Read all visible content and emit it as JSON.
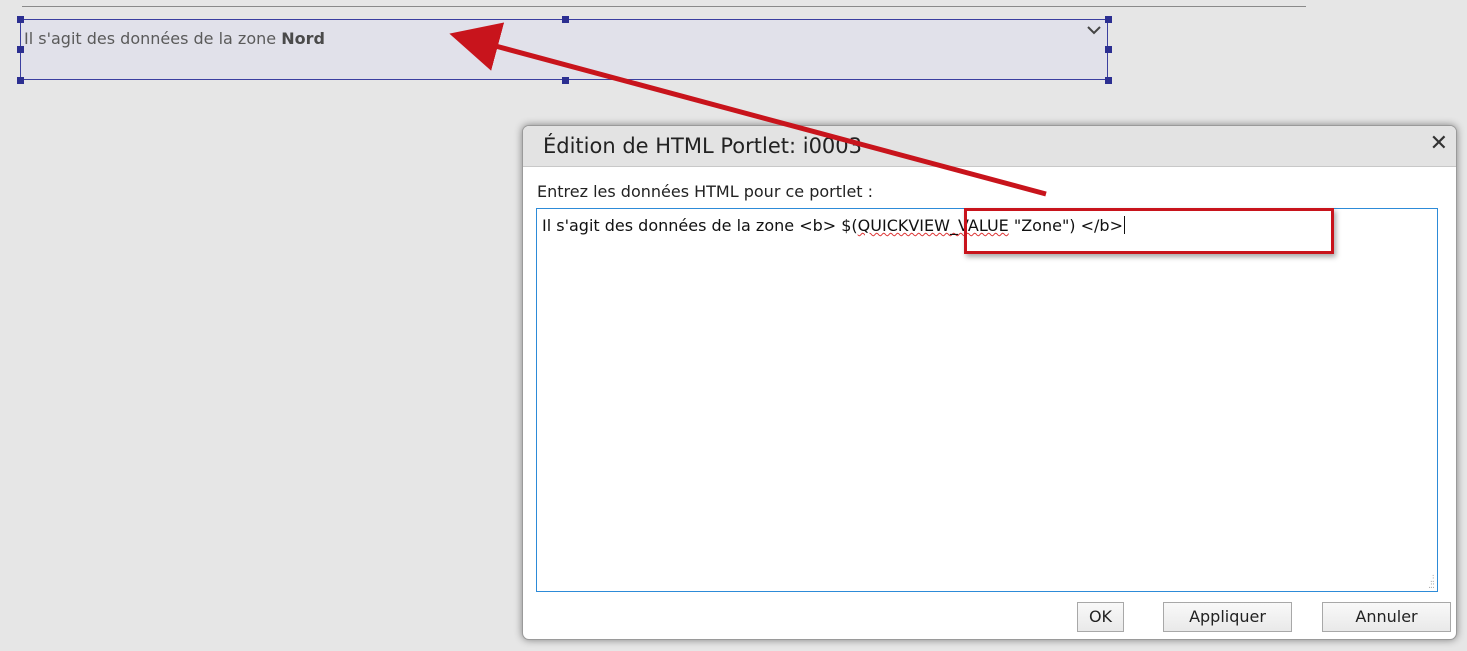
{
  "portlet": {
    "text_prefix": "Il s'agit des données de la zone ",
    "text_bold": "Nord",
    "menu_icon": "chevron-down-icon"
  },
  "dialog": {
    "title": "Édition de HTML Portlet: i0003",
    "close_label": "✕",
    "prompt": "Entrez les données HTML pour ce portlet :",
    "editor_value": {
      "part1": "Il s'agit des données de la zone <b> $(",
      "part2": "QUICKVIEW_VALUE",
      "part3": " \"Zone\") </b>"
    },
    "buttons": {
      "ok": "OK",
      "apply": "Appliquer",
      "cancel": "Annuler"
    }
  },
  "annotations": {
    "color": "#c8141c"
  }
}
